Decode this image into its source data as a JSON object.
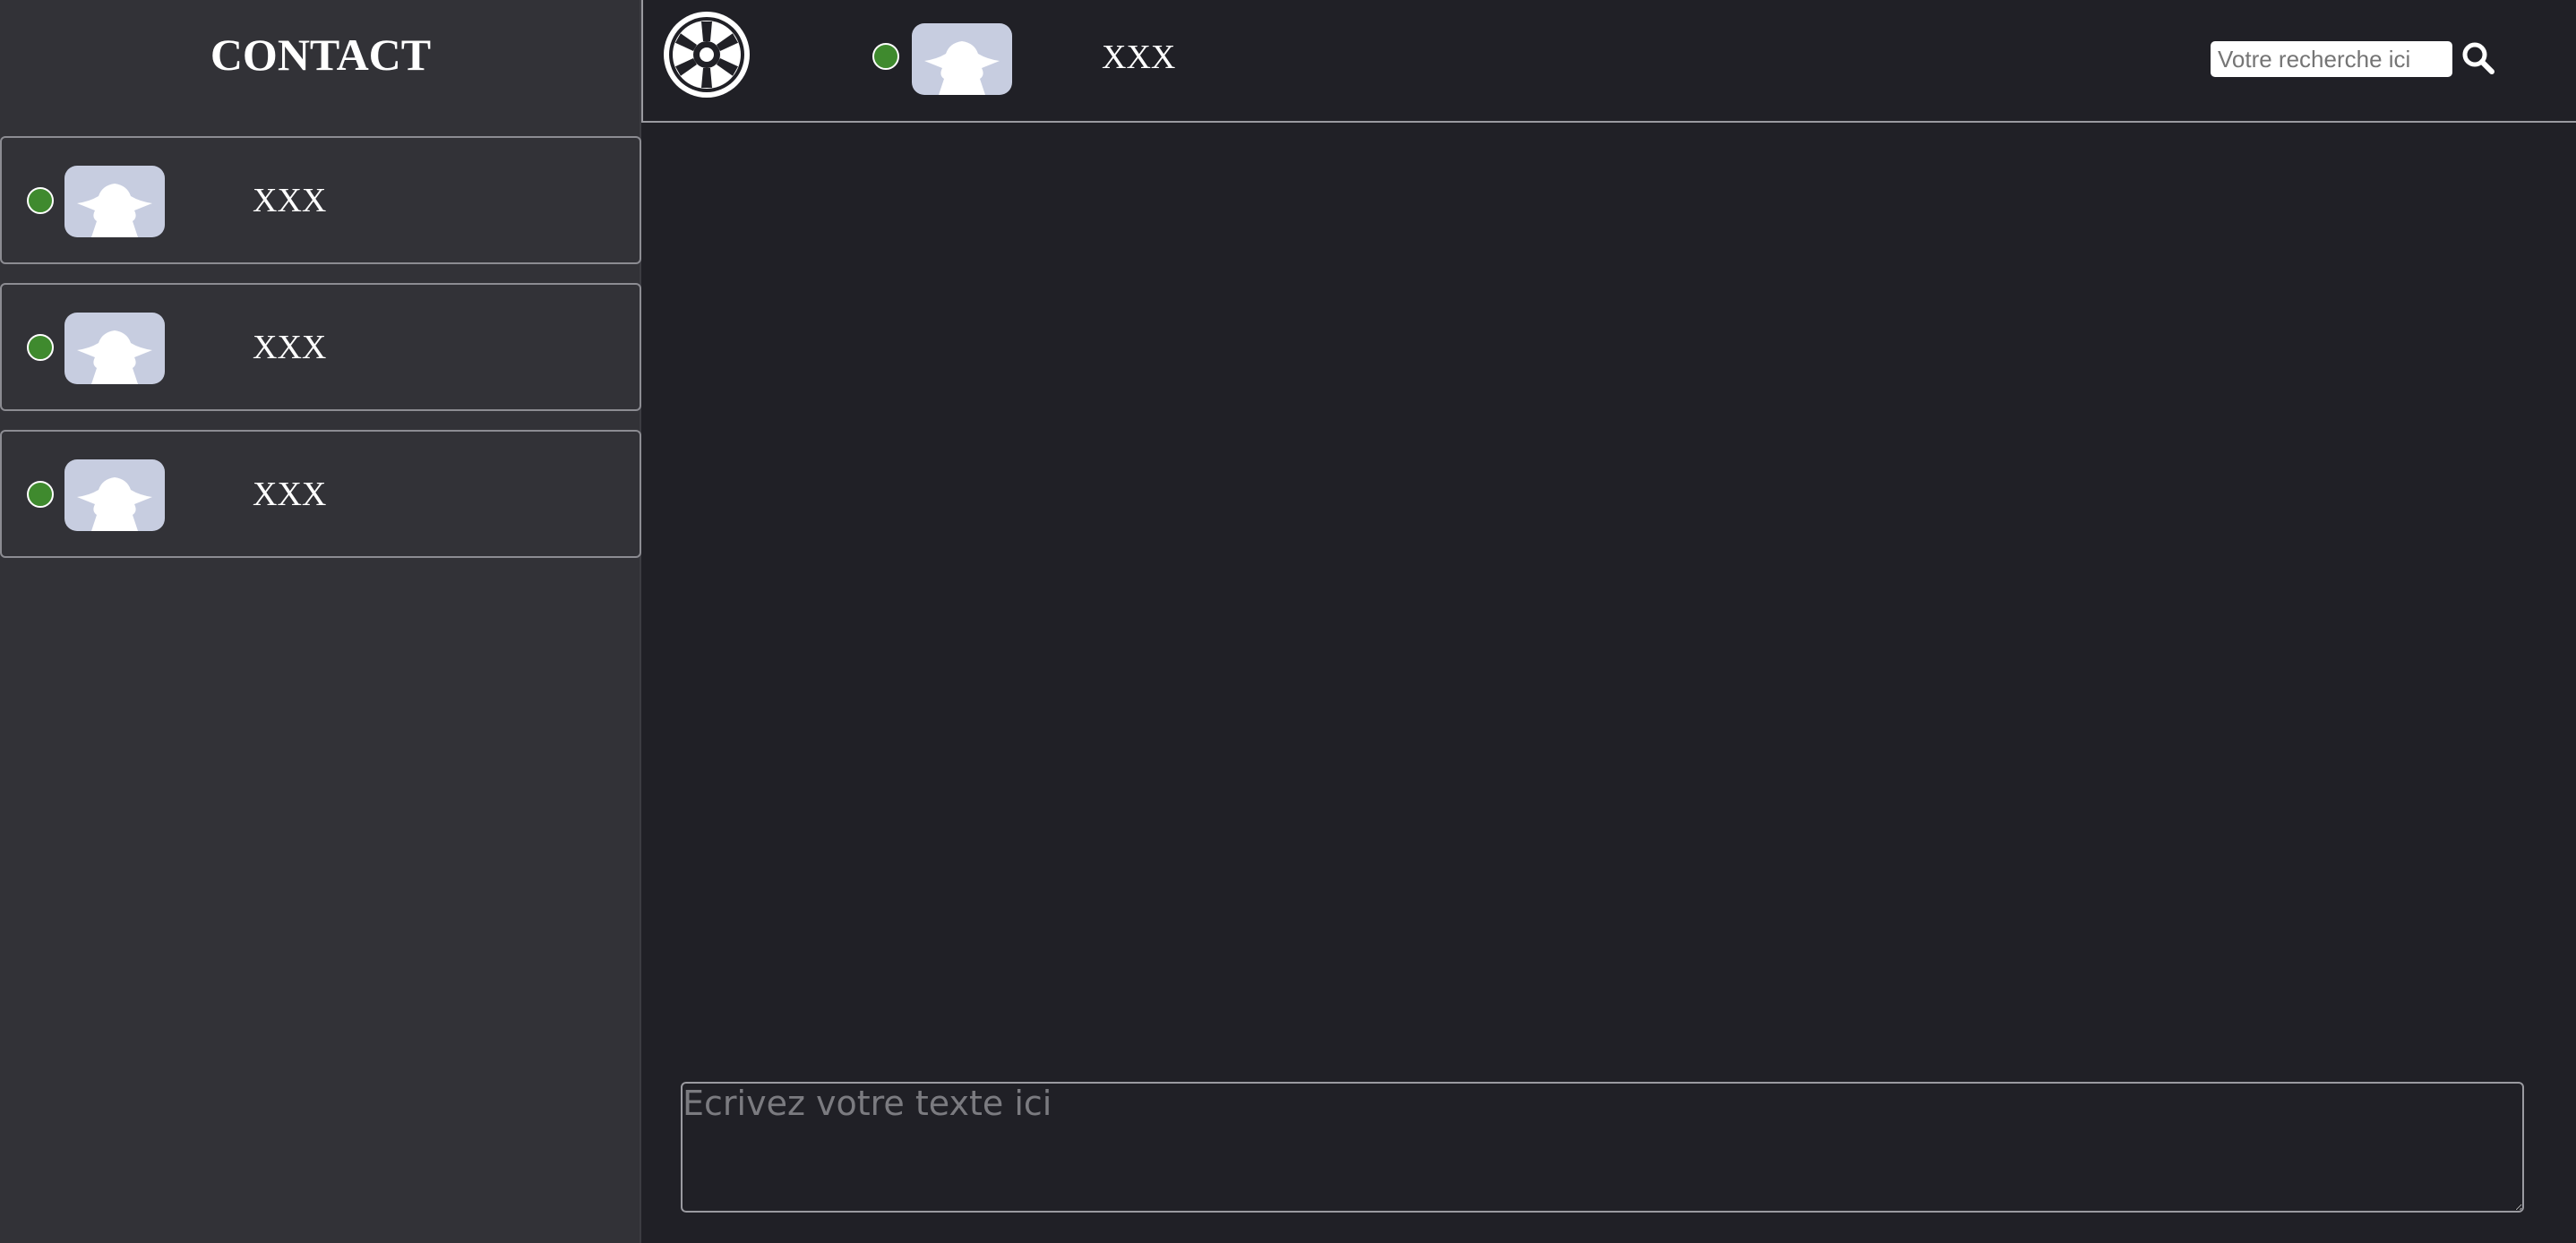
{
  "sidebar": {
    "title": "CONTACT",
    "contacts": [
      {
        "name": "XXX",
        "status": "online",
        "avatar_icon": "yoda-silhouette-icon"
      },
      {
        "name": "XXX",
        "status": "online",
        "avatar_icon": "yoda-silhouette-icon"
      },
      {
        "name": "XXX",
        "status": "online",
        "avatar_icon": "yoda-silhouette-icon"
      }
    ]
  },
  "header": {
    "logo_icon": "galactic-empire-emblem-icon",
    "active_contact": {
      "name": "XXX",
      "status": "online",
      "avatar_icon": "yoda-silhouette-icon"
    },
    "search": {
      "placeholder": "Votre recherche ici",
      "value": "",
      "icon": "search-icon"
    }
  },
  "composer": {
    "placeholder": "Ecrivez votre texte ici",
    "value": ""
  },
  "colors": {
    "sidebar_bg": "#323237",
    "main_bg": "#202026",
    "status_online": "#3f8a2e",
    "avatar_bg": "#c7cde0",
    "border": "#9a9aa0",
    "text": "#ffffff"
  }
}
